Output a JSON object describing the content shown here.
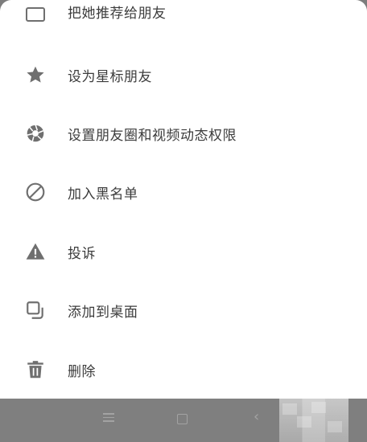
{
  "menu": {
    "items": [
      {
        "label": "把她推荐给朋友",
        "icon": "share-card-icon"
      },
      {
        "label": "设为星标朋友",
        "icon": "star-icon"
      },
      {
        "label": "设置朋友圈和视频动态权限",
        "icon": "aperture-icon"
      },
      {
        "label": "加入黑名单",
        "icon": "block-icon"
      },
      {
        "label": "投诉",
        "icon": "warning-icon"
      },
      {
        "label": "添加到桌面",
        "icon": "add-to-desktop-icon"
      },
      {
        "label": "删除",
        "icon": "trash-icon"
      }
    ]
  },
  "navbar": {
    "buttons": [
      "menu-icon",
      "home-icon",
      "back-icon"
    ],
    "back_glyph": "‹"
  },
  "colors": {
    "sheet": "#ffffff",
    "overlay": "#8a8a8a",
    "icon": "#6f6f6f",
    "text": "#3c3c3c"
  }
}
